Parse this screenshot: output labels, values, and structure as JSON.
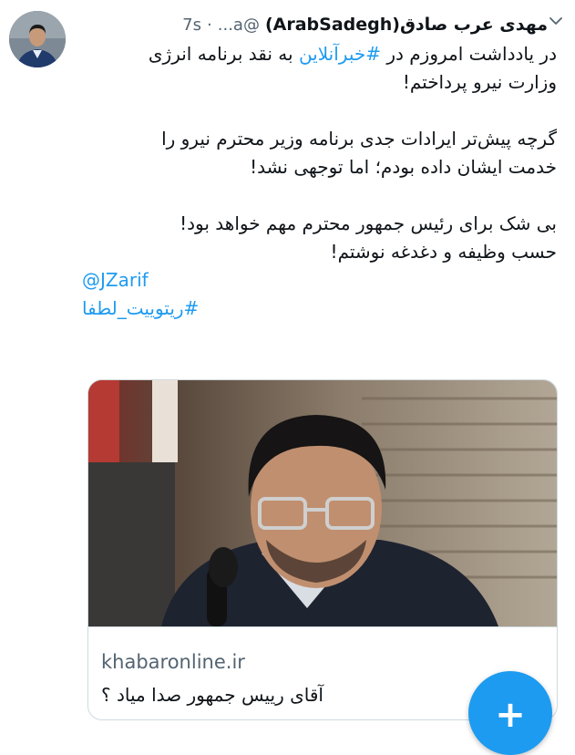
{
  "tweet": {
    "display_name": "مهدی عرب صادق(ArabSadegh)",
    "handle": "@a...",
    "separator": "·",
    "time": "7s",
    "more_icon": "chevron-down-icon",
    "line1_before": "در یادداشت امروزم در ",
    "line1_hashtag": "#خبرآنلاین",
    "line1_after": " به نقد برنامه انرژی",
    "line2": "وزارت نیرو پرداختم!",
    "line3": "گرچه پیش‌تر ایرادات جدی برنامه وزیر محترم نیرو را",
    "line4": "خدمت ایشان داده بودم؛ اما توجهی نشد!",
    "line5": "بی شک برای رئیس جمهور محترم مهم خواهد بود!",
    "line6": "حسب وظیفه و دغدغه نوشتم!",
    "mention": "@JZarif",
    "hashtag2": "#ریتوییت_لطفا"
  },
  "card": {
    "domain": "khabaronline.ir",
    "title": "آقای رییس جمهور صدا میاد ؟"
  },
  "fab": {
    "label": "+",
    "icon": "compose-plus-icon"
  },
  "colors": {
    "accent": "#1d9bf0",
    "text": "#0f1419",
    "secondary": "#536471",
    "border": "#cfd9de"
  }
}
